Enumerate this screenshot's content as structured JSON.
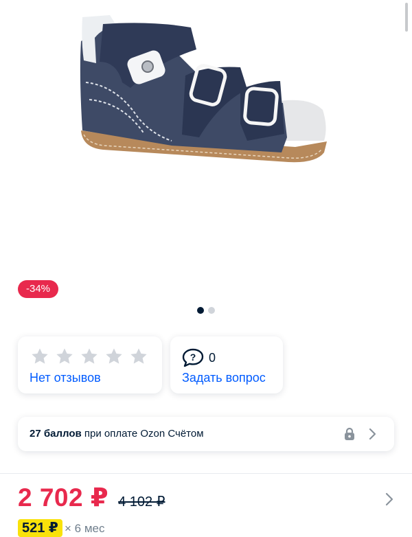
{
  "product": {
    "image_alt": "Blue children's sandal with white buckles",
    "discount_badge": "-34%",
    "carousel": {
      "total": 2,
      "active": 1
    }
  },
  "reviews": {
    "stars_filled": 0,
    "stars_total": 5,
    "label": "Нет отзывов"
  },
  "questions": {
    "icon": "question-bubble-icon",
    "count": "0",
    "label": "Задать вопрос"
  },
  "bonus": {
    "bold": "27 баллов",
    "text": " при оплате Ozon Счётом",
    "icons": [
      "lock-icon",
      "chevron-right-icon"
    ]
  },
  "price": {
    "current": "2 702 ₽",
    "old": "4 102 ₽",
    "installment_badge": "521 ₽",
    "installment_text": "× 6 мес"
  },
  "colors": {
    "accent_red": "#e8294d",
    "link_blue": "#005bff",
    "text_dark": "#001a34",
    "star_gray": "#d0d4da"
  }
}
